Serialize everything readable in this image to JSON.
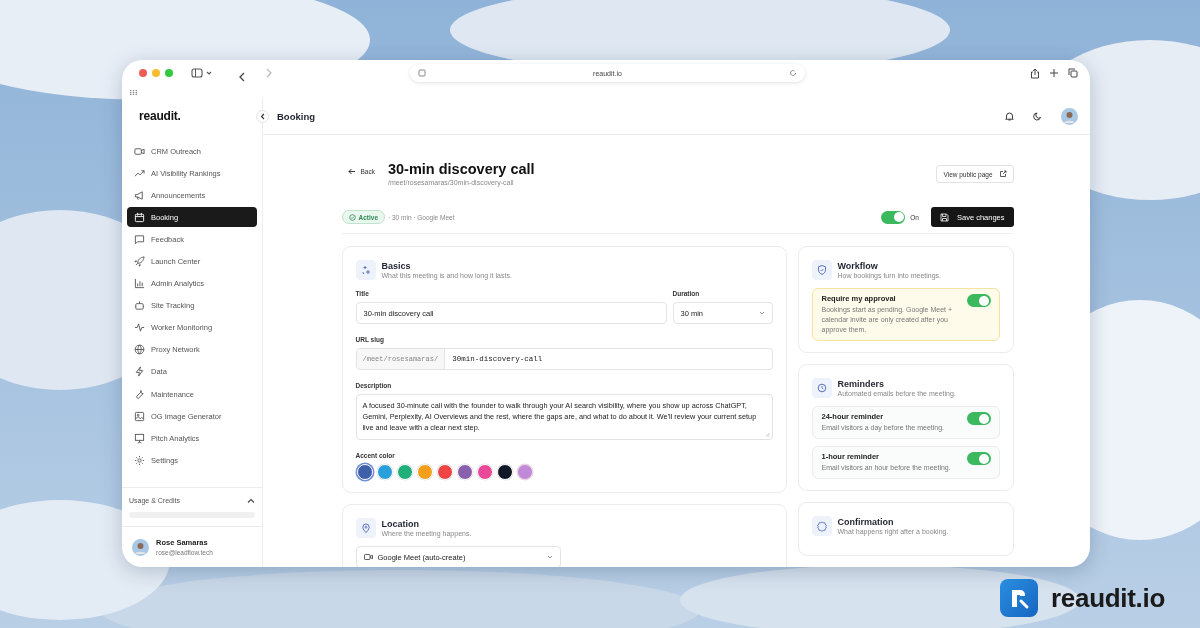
{
  "browser": {
    "url": "reaudit.io"
  },
  "sidebar": {
    "logo": "reaudit.",
    "items": [
      {
        "label": "CRM Outreach",
        "selected": false
      },
      {
        "label": "AI Visibility Rankings",
        "selected": false
      },
      {
        "label": "Announcements",
        "selected": false
      },
      {
        "label": "Booking",
        "selected": true
      },
      {
        "label": "Feedback",
        "selected": false
      },
      {
        "label": "Launch Center",
        "selected": false
      },
      {
        "label": "Admin Analytics",
        "selected": false
      },
      {
        "label": "Site Tracking",
        "selected": false
      },
      {
        "label": "Worker Monitoring",
        "selected": false
      },
      {
        "label": "Proxy Network",
        "selected": false
      },
      {
        "label": "Data",
        "selected": false
      },
      {
        "label": "Maintenance",
        "selected": false
      },
      {
        "label": "OG Image Generator",
        "selected": false
      },
      {
        "label": "Pitch Analytics",
        "selected": false
      },
      {
        "label": "Settings",
        "selected": false
      }
    ],
    "usage": {
      "label": "Usage & Credits",
      "expanded": true
    },
    "user": {
      "name": "Rose Samaras",
      "email": "rose@leadflow.tech"
    }
  },
  "header": {
    "title": "Booking"
  },
  "page": {
    "back": "Back",
    "title": "30-min discovery call",
    "slug": "/meet/rosesamaras/30min-discovery-call",
    "view_button": "View public page",
    "status": "Active",
    "meta": "· 30 min · Google Meet",
    "toggle": {
      "label": "On",
      "on": true
    },
    "save_button": "Save changes"
  },
  "basics": {
    "title": "Basics",
    "subtitle": "What this meeting is and how long it lasts.",
    "title_field": {
      "label": "Title",
      "value": "30-min discovery call"
    },
    "duration": {
      "label": "Duration",
      "value": "30 min"
    },
    "url_slug": {
      "label": "URL slug",
      "prefix": "/meet/rosesamaras/",
      "value": "30min-discovery-call"
    },
    "description": {
      "label": "Description",
      "value": "A focused 30-minute call with the founder to walk through your AI search visibility, where you show up across ChatGPT, Gemini, Perplexity, AI Overviews and the rest, where the gaps are, and what to do about it. We'll review your current setup live and leave with a clear next step."
    },
    "accent": {
      "label": "Accent color",
      "colors": [
        {
          "kind": "solid",
          "color": "#3f5faa",
          "selected": true
        },
        {
          "kind": "solid",
          "color": "#28a0dc",
          "selected": false
        },
        {
          "kind": "solid",
          "color": "#1fb07a",
          "selected": false
        },
        {
          "kind": "solid",
          "color": "#f59e1c",
          "selected": false
        },
        {
          "kind": "solid",
          "color": "#ee4444",
          "selected": false
        },
        {
          "kind": "solid",
          "color": "#8a5fae",
          "selected": false
        },
        {
          "kind": "solid",
          "color": "#ec4899",
          "selected": false
        },
        {
          "kind": "solid",
          "color": "#111827",
          "selected": false
        },
        {
          "kind": "custom",
          "color": "#c08ad6",
          "selected": false
        }
      ]
    }
  },
  "location": {
    "title": "Location",
    "subtitle": "Where the meeting happens.",
    "select": "Google Meet (auto-create)"
  },
  "workflow": {
    "title": "Workflow",
    "subtitle": "How bookings turn into meetings.",
    "approval": {
      "title": "Require my approval",
      "text": "Bookings start as pending. Google Meet + calendar invite are only created after you approve them.",
      "on": true
    }
  },
  "reminders": {
    "title": "Reminders",
    "subtitle": "Automated emails before the meeting.",
    "items": [
      {
        "title": "24-hour reminder",
        "text": "Email visitors a day before the meeting.",
        "on": true
      },
      {
        "title": "1-hour reminder",
        "text": "Email visitors an hour before the meeting.",
        "on": true
      }
    ]
  },
  "confirmation": {
    "title": "Confirmation",
    "subtitle": "What happens right after a booking."
  },
  "brand": {
    "name": "reaudit.io"
  }
}
